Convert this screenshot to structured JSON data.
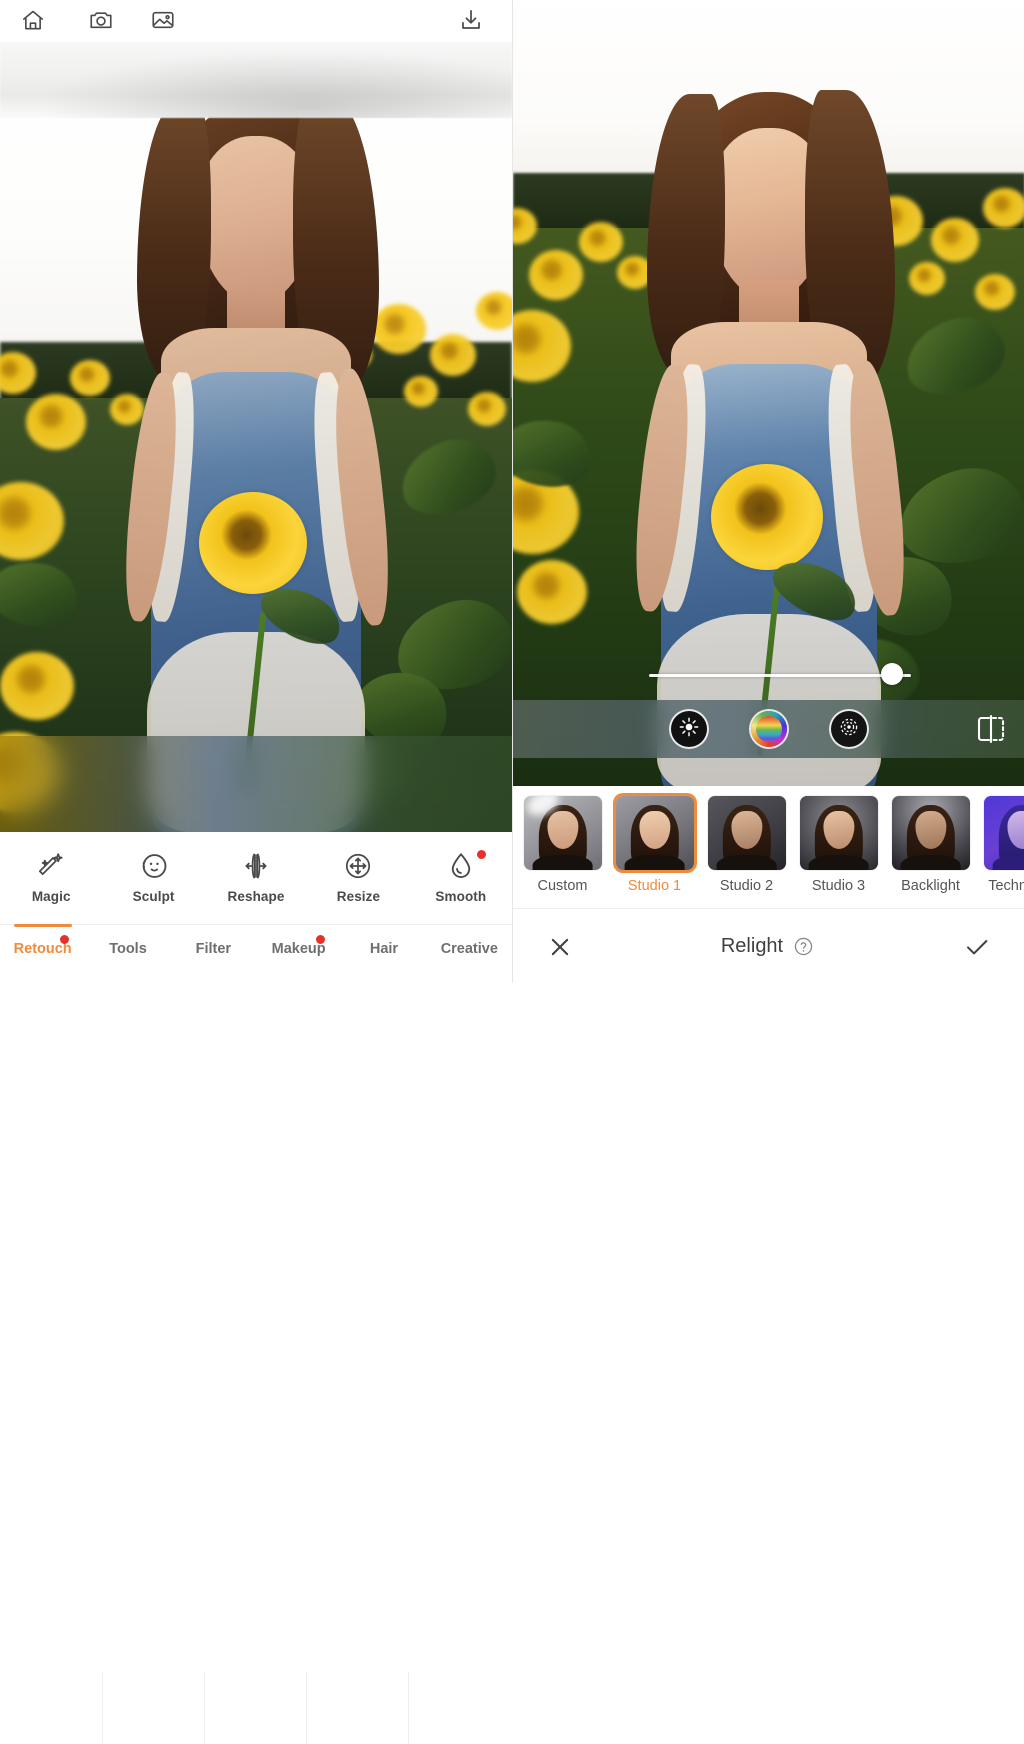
{
  "app": {
    "accent_color": "#ef8b3c",
    "badge_color": "#e8302a"
  },
  "left_pane": {
    "topbar": {
      "home_label": "home-icon",
      "camera_label": "camera-icon",
      "gallery_label": "gallery-icon",
      "download_label": "download-icon"
    },
    "tools": [
      {
        "label": "Magic",
        "icon": "magic-wand-icon",
        "badge": false
      },
      {
        "label": "Sculpt",
        "icon": "face-sculpt-icon",
        "badge": false
      },
      {
        "label": "Reshape",
        "icon": "reshape-icon",
        "badge": false
      },
      {
        "label": "Resize",
        "icon": "resize-icon",
        "badge": false
      },
      {
        "label": "Smooth",
        "icon": "droplet-icon",
        "badge": true
      }
    ],
    "tabs": [
      {
        "label": "Retouch",
        "active": true,
        "badge": true
      },
      {
        "label": "Tools",
        "active": false,
        "badge": false
      },
      {
        "label": "Filter",
        "active": false,
        "badge": false
      },
      {
        "label": "Makeup",
        "active": false,
        "badge": true
      },
      {
        "label": "Hair",
        "active": false,
        "badge": false
      },
      {
        "label": "Creative",
        "active": false,
        "badge": false
      }
    ]
  },
  "right_pane": {
    "slider": {
      "value_percent": 93
    },
    "modes": [
      {
        "name": "brightness",
        "icon": "sun-brightness-icon"
      },
      {
        "name": "color",
        "icon": "color-wheel-icon"
      },
      {
        "name": "texture",
        "icon": "aperture-texture-icon"
      }
    ],
    "compare_icon": "before-after-compare-icon",
    "presets": [
      {
        "label": "Custom",
        "selected": false
      },
      {
        "label": "Studio 1",
        "selected": true
      },
      {
        "label": "Studio 2",
        "selected": false
      },
      {
        "label": "Studio 3",
        "selected": false
      },
      {
        "label": "Backlight",
        "selected": false
      },
      {
        "label": "Technicolo",
        "selected": false
      }
    ],
    "actionbar": {
      "cancel_icon": "close-x-icon",
      "title": "Relight",
      "help_icon": "help-question-icon",
      "confirm_icon": "checkmark-icon"
    }
  }
}
